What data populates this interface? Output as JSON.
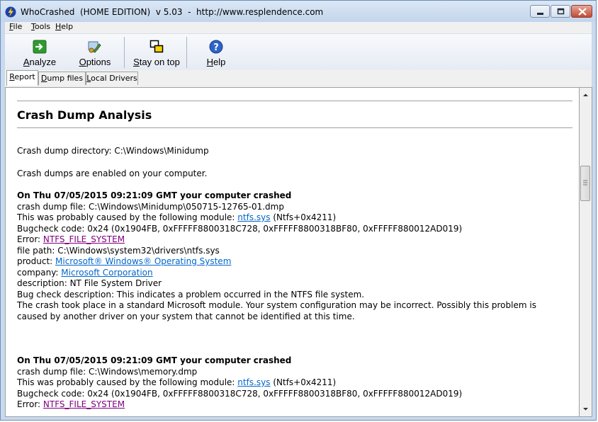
{
  "window": {
    "title": "WhoCrashed  (HOME EDITION)  v 5.03  -  http://www.resplendence.com"
  },
  "menu": [
    "File",
    "Tools",
    "Help"
  ],
  "toolbar": {
    "analyze": "Analyze",
    "options": "Options",
    "stay_on_top": "Stay on top",
    "help": "Help"
  },
  "tabs": [
    "Report",
    "Dump files",
    "Local Drivers"
  ],
  "report": {
    "heading": "Crash Dump Analysis",
    "dump_dir": "Crash dump directory: C:\\Windows\\Minidump",
    "enabled": "Crash dumps are enabled on your computer.",
    "crash1": {
      "title": "On Thu 07/05/2015 09:21:09 GMT your computer crashed",
      "file": "crash dump file: C:\\Windows\\Minidump\\050715-12765-01.dmp",
      "cause_prefix": "This was probably caused by the following module: ",
      "module": "ntfs.sys",
      "module_suffix": " (Ntfs+0x4211)",
      "bugcheck": "Bugcheck code: 0x24 (0x1904FB, 0xFFFFF8800318C728, 0xFFFFF8800318BF80, 0xFFFFF880012AD019)",
      "error_prefix": "Error: ",
      "error": "NTFS_FILE_SYSTEM",
      "file_path": "file path: C:\\Windows\\system32\\drivers\\ntfs.sys",
      "product_prefix": "product: ",
      "product": "Microsoft® Windows® Operating System",
      "company_prefix": "company: ",
      "company": "Microsoft Corporation",
      "description": "description: NT File System Driver",
      "bugcheck_desc": "Bug check description: This indicates a problem occurred in the NTFS file system.",
      "note": "The crash took place in a standard Microsoft module. Your system configuration may be incorrect. Possibly this problem is caused by another driver on your system that cannot be identified at this time."
    },
    "crash2": {
      "title": "On Thu 07/05/2015 09:21:09 GMT your computer crashed",
      "file": "crash dump file: C:\\Windows\\memory.dmp",
      "cause_prefix": "This was probably caused by the following module: ",
      "module": "ntfs.sys",
      "module_suffix": " (Ntfs+0x4211)",
      "bugcheck": "Bugcheck code: 0x24 (0x1904FB, 0xFFFFF8800318C728, 0xFFFFF8800318BF80, 0xFFFFF880012AD019)",
      "error_prefix": "Error: ",
      "error": "NTFS_FILE_SYSTEM"
    }
  },
  "colors": {
    "link": "#0066cc",
    "visited_link": "#800080",
    "chrome": "#c9d9ee"
  }
}
